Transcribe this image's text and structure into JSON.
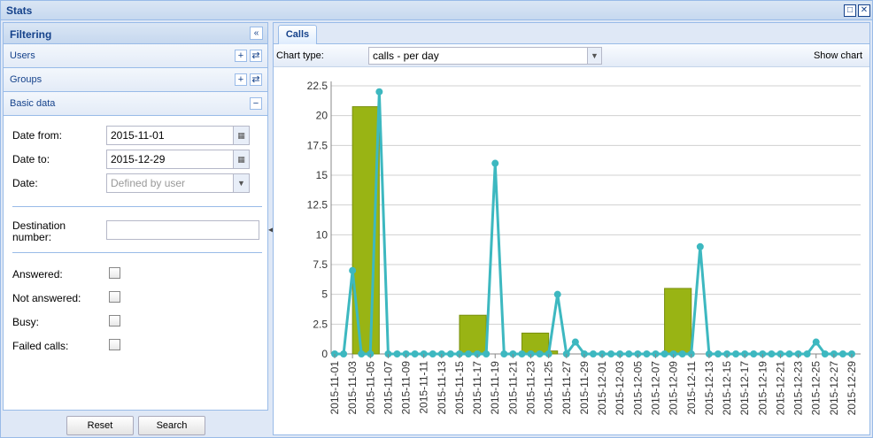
{
  "window": {
    "title": "Stats"
  },
  "filter": {
    "title": "Filtering",
    "sections": {
      "users": "Users",
      "groups": "Groups",
      "basic": "Basic data"
    },
    "date_from": {
      "label": "Date from:",
      "value": "2015-11-01"
    },
    "date_to": {
      "label": "Date to:",
      "value": "2015-12-29"
    },
    "date": {
      "label": "Date:",
      "placeholder": "Defined by user"
    },
    "destination": {
      "label1": "Destination",
      "label2": "number:",
      "value": ""
    },
    "checks": [
      "Answered:",
      "Not answered:",
      "Busy:",
      "Failed calls:"
    ],
    "reset": "Reset",
    "search": "Search"
  },
  "tabs": {
    "calls": "Calls"
  },
  "toolbar": {
    "chart_type_label": "Chart type:",
    "chart_type_value": "calls - per day",
    "show_chart": "Show chart"
  },
  "colors": {
    "bar": "#99b414",
    "line": "#3db8c0",
    "grid": "#d0d0d0"
  },
  "chart_data": {
    "type": "bar+line",
    "ylim": [
      0,
      22.5
    ],
    "yticks": [
      0,
      2.5,
      5,
      7.5,
      10,
      12.5,
      15,
      17.5,
      20,
      22.5
    ],
    "x": [
      "2015-11-01",
      "2015-11-02",
      "2015-11-03",
      "2015-11-04",
      "2015-11-05",
      "2015-11-06",
      "2015-11-07",
      "2015-11-08",
      "2015-11-09",
      "2015-11-10",
      "2015-11-11",
      "2015-11-12",
      "2015-11-13",
      "2015-11-14",
      "2015-11-15",
      "2015-11-16",
      "2015-11-17",
      "2015-11-18",
      "2015-11-19",
      "2015-11-20",
      "2015-11-21",
      "2015-11-22",
      "2015-11-23",
      "2015-11-24",
      "2015-11-25",
      "2015-11-26",
      "2015-11-27",
      "2015-11-28",
      "2015-11-29",
      "2015-11-30",
      "2015-12-01",
      "2015-12-02",
      "2015-12-03",
      "2015-12-04",
      "2015-12-05",
      "2015-12-06",
      "2015-12-07",
      "2015-12-08",
      "2015-12-09",
      "2015-12-10",
      "2015-12-11",
      "2015-12-12",
      "2015-12-13",
      "2015-12-14",
      "2015-12-15",
      "2015-12-16",
      "2015-12-17",
      "2015-12-18",
      "2015-12-19",
      "2015-12-20",
      "2015-12-21",
      "2015-12-22",
      "2015-12-23",
      "2015-12-24",
      "2015-12-25",
      "2015-12-26",
      "2015-12-27",
      "2015-12-28",
      "2015-12-29"
    ],
    "xticks": [
      "2015-11-01",
      "2015-11-03",
      "2015-11-05",
      "2015-11-07",
      "2015-11-09",
      "2015-11-11",
      "2015-11-13",
      "2015-11-15",
      "2015-11-17",
      "2015-11-19",
      "2015-11-21",
      "2015-11-23",
      "2015-11-25",
      "2015-11-27",
      "2015-11-29",
      "2015-12-01",
      "2015-12-03",
      "2015-12-05",
      "2015-12-07",
      "2015-12-09",
      "2015-12-11",
      "2015-12-13",
      "2015-12-15",
      "2015-12-17",
      "2015-12-19",
      "2015-12-21",
      "2015-12-23",
      "2015-12-25",
      "2015-12-27",
      "2015-12-29"
    ],
    "bars": [
      {
        "from": "2015-11-03",
        "to": "2015-11-06",
        "value": 20.75
      },
      {
        "from": "2015-11-15",
        "to": "2015-11-18",
        "value": 3.25
      },
      {
        "from": "2015-11-22",
        "to": "2015-11-25",
        "value": 1.75
      },
      {
        "from": "2015-11-25",
        "to": "2015-11-26",
        "value": 0.25
      },
      {
        "from": "2015-12-08",
        "to": "2015-12-11",
        "value": 5.5
      }
    ],
    "line_values": [
      0,
      0,
      7,
      0,
      0,
      22,
      0,
      0,
      0,
      0,
      0,
      0,
      0,
      0,
      0,
      0,
      0,
      0,
      16,
      0,
      0,
      0,
      0,
      0,
      0,
      5,
      0,
      1,
      0,
      0,
      0,
      0,
      0,
      0,
      0,
      0,
      0,
      0,
      0,
      0,
      0,
      9,
      0,
      0,
      0,
      0,
      0,
      0,
      0,
      0,
      0,
      0,
      0,
      0,
      1,
      0,
      0,
      0,
      0,
      0
    ]
  }
}
